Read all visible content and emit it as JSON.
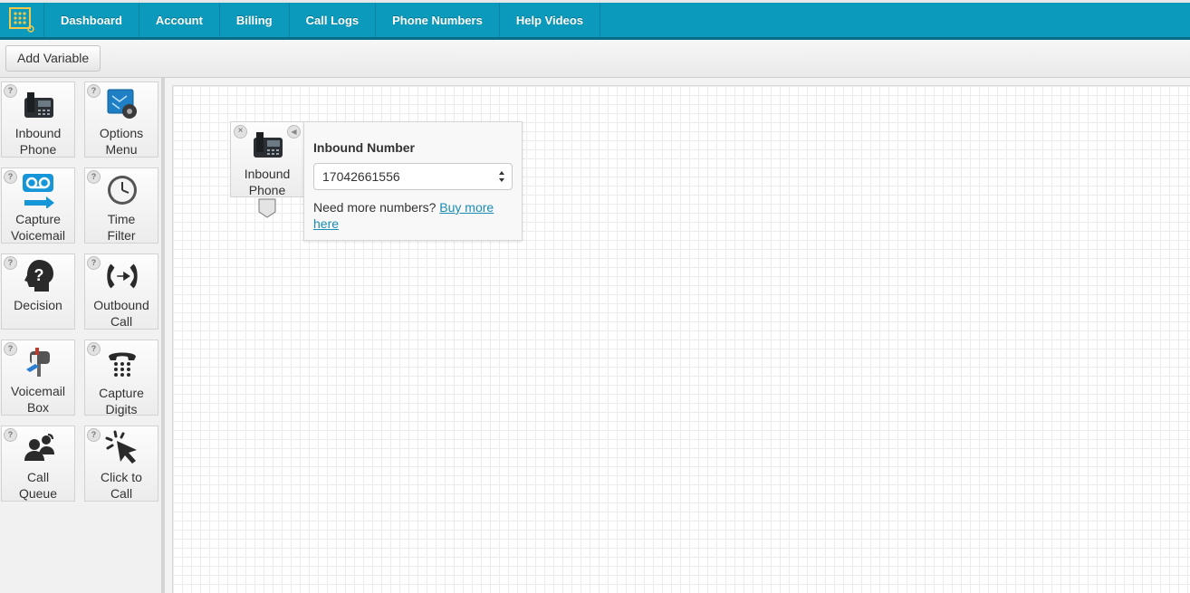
{
  "nav": {
    "logo_icon": "grid-logo-icon",
    "items": [
      "Dashboard",
      "Account",
      "Billing",
      "Call Logs",
      "Phone Numbers",
      "Help Videos"
    ]
  },
  "toolbar": {
    "add_variable_label": "Add Variable"
  },
  "sidebar": {
    "help_glyph": "?",
    "tools": [
      {
        "line1": "Inbound",
        "line2": "Phone",
        "icon": "desk-phone-icon"
      },
      {
        "line1": "Options",
        "line2": "Menu",
        "icon": "options-menu-icon"
      },
      {
        "line1": "Capture",
        "line2": "Voicemail",
        "icon": "voicemail-icon"
      },
      {
        "line1": "Time",
        "line2": "Filter",
        "icon": "clock-icon"
      },
      {
        "line1": "Decision",
        "line2": "",
        "icon": "question-head-icon"
      },
      {
        "line1": "Outbound",
        "line2": "Call",
        "icon": "outbound-call-icon"
      },
      {
        "line1": "Voicemail",
        "line2": "Box",
        "icon": "voicemail-box-icon"
      },
      {
        "line1": "Capture",
        "line2": "Digits",
        "icon": "keypad-phone-icon"
      },
      {
        "line1": "Call",
        "line2": "Queue",
        "icon": "call-queue-icon"
      },
      {
        "line1": "Click to",
        "line2": "Call",
        "icon": "click-cursor-icon"
      }
    ]
  },
  "canvas": {
    "node": {
      "line1": "Inbound",
      "line2": "Phone",
      "close_glyph": "×",
      "collapse_glyph": "◀"
    },
    "panel": {
      "title": "Inbound Number",
      "selected_number": "17042661556",
      "more_text": "Need more numbers?",
      "link_text": "Buy more here"
    }
  },
  "colors": {
    "nav_bg": "#0b9abc",
    "link": "#1a8cb4"
  }
}
